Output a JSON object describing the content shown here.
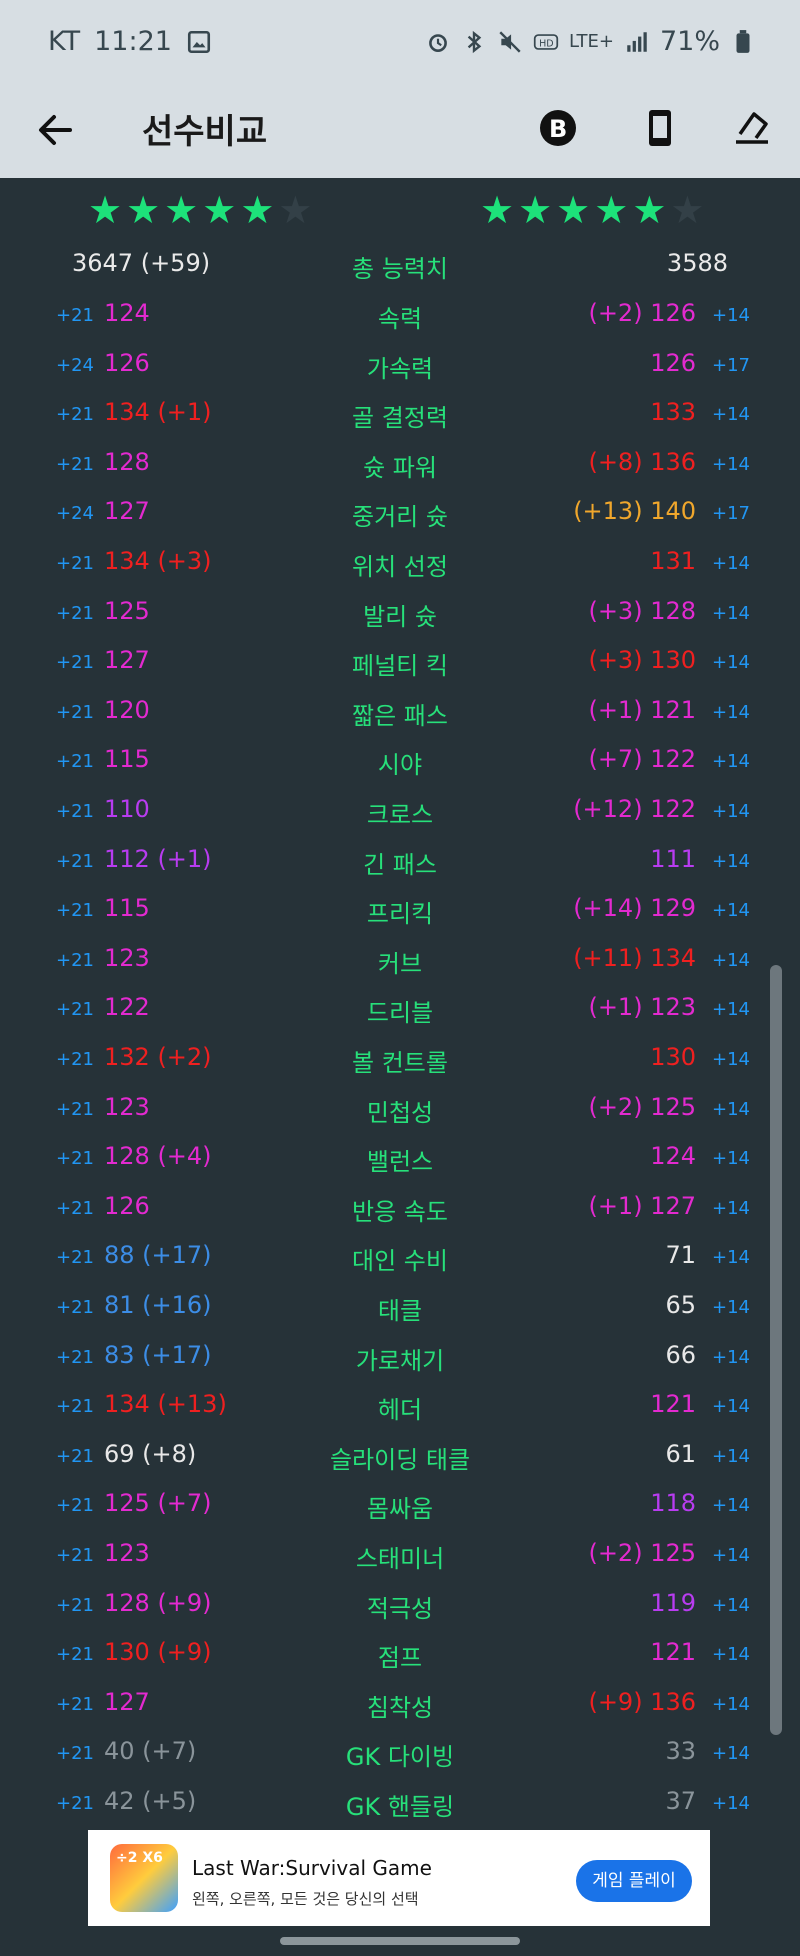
{
  "status": {
    "carrier": "KT",
    "time": "11:21",
    "battery": "71%",
    "net": "LTE+"
  },
  "appbar": {
    "title": "선수비교"
  },
  "stars": {
    "left_on": 5,
    "right_on": 5,
    "total": 6
  },
  "total": {
    "label": "총 능력치",
    "left": "3647 (+59)",
    "right": "3588"
  },
  "rows": [
    {
      "lb": "+21",
      "lv": "124",
      "lc": "c-mag",
      "label": "속력",
      "rv": "(+2) 126",
      "rc": "c-mag",
      "rb": "+14"
    },
    {
      "lb": "+24",
      "lv": "126",
      "lc": "c-mag",
      "label": "가속력",
      "rv": "126",
      "rc": "c-mag",
      "rb": "+17"
    },
    {
      "lb": "+21",
      "lv": "134 (+1)",
      "lc": "c-red",
      "label": "골 결정력",
      "rv": "133",
      "rc": "c-red",
      "rb": "+14"
    },
    {
      "lb": "+21",
      "lv": "128",
      "lc": "c-mag",
      "label": "슛 파워",
      "rv": "(+8) 136",
      "rc": "c-red",
      "rb": "+14"
    },
    {
      "lb": "+24",
      "lv": "127",
      "lc": "c-mag",
      "label": "중거리 슛",
      "rv": "(+13) 140",
      "rc": "c-org",
      "rb": "+17"
    },
    {
      "lb": "+21",
      "lv": "134 (+3)",
      "lc": "c-red",
      "label": "위치 선정",
      "rv": "131",
      "rc": "c-red",
      "rb": "+14"
    },
    {
      "lb": "+21",
      "lv": "125",
      "lc": "c-mag",
      "label": "발리 슛",
      "rv": "(+3) 128",
      "rc": "c-mag",
      "rb": "+14"
    },
    {
      "lb": "+21",
      "lv": "127",
      "lc": "c-mag",
      "label": "페널티 킥",
      "rv": "(+3) 130",
      "rc": "c-red",
      "rb": "+14"
    },
    {
      "lb": "+21",
      "lv": "120",
      "lc": "c-mag",
      "label": "짧은 패스",
      "rv": "(+1) 121",
      "rc": "c-mag",
      "rb": "+14"
    },
    {
      "lb": "+21",
      "lv": "115",
      "lc": "c-mag",
      "label": "시야",
      "rv": "(+7) 122",
      "rc": "c-mag",
      "rb": "+14"
    },
    {
      "lb": "+21",
      "lv": "110",
      "lc": "c-pur",
      "label": "크로스",
      "rv": "(+12) 122",
      "rc": "c-mag",
      "rb": "+14"
    },
    {
      "lb": "+21",
      "lv": "112 (+1)",
      "lc": "c-pur",
      "label": "긴 패스",
      "rv": "111",
      "rc": "c-pur",
      "rb": "+14"
    },
    {
      "lb": "+21",
      "lv": "115",
      "lc": "c-mag",
      "label": "프리킥",
      "rv": "(+14) 129",
      "rc": "c-mag",
      "rb": "+14"
    },
    {
      "lb": "+21",
      "lv": "123",
      "lc": "c-mag",
      "label": "커브",
      "rv": "(+11) 134",
      "rc": "c-red",
      "rb": "+14"
    },
    {
      "lb": "+21",
      "lv": "122",
      "lc": "c-mag",
      "label": "드리블",
      "rv": "(+1) 123",
      "rc": "c-mag",
      "rb": "+14"
    },
    {
      "lb": "+21",
      "lv": "132 (+2)",
      "lc": "c-red",
      "label": "볼 컨트롤",
      "rv": "130",
      "rc": "c-red",
      "rb": "+14"
    },
    {
      "lb": "+21",
      "lv": "123",
      "lc": "c-mag",
      "label": "민첩성",
      "rv": "(+2) 125",
      "rc": "c-mag",
      "rb": "+14"
    },
    {
      "lb": "+21",
      "lv": "128 (+4)",
      "lc": "c-mag",
      "label": "밸런스",
      "rv": "124",
      "rc": "c-mag",
      "rb": "+14"
    },
    {
      "lb": "+21",
      "lv": "126",
      "lc": "c-mag",
      "label": "반응 속도",
      "rv": "(+1) 127",
      "rc": "c-mag",
      "rb": "+14"
    },
    {
      "lb": "+21",
      "lv": "88 (+17)",
      "lc": "c-blu",
      "label": "대인 수비",
      "rv": "71",
      "rc": "c-wht",
      "rb": "+14"
    },
    {
      "lb": "+21",
      "lv": "81 (+16)",
      "lc": "c-blu",
      "label": "태클",
      "rv": "65",
      "rc": "c-wht",
      "rb": "+14"
    },
    {
      "lb": "+21",
      "lv": "83 (+17)",
      "lc": "c-blu",
      "label": "가로채기",
      "rv": "66",
      "rc": "c-wht",
      "rb": "+14"
    },
    {
      "lb": "+21",
      "lv": "134 (+13)",
      "lc": "c-red",
      "label": "헤더",
      "rv": "121",
      "rc": "c-mag",
      "rb": "+14"
    },
    {
      "lb": "+21",
      "lv": "69 (+8)",
      "lc": "c-wht",
      "label": "슬라이딩 태클",
      "rv": "61",
      "rc": "c-wht",
      "rb": "+14"
    },
    {
      "lb": "+21",
      "lv": "125 (+7)",
      "lc": "c-mag",
      "label": "몸싸움",
      "rv": "118",
      "rc": "c-pur",
      "rb": "+14"
    },
    {
      "lb": "+21",
      "lv": "123",
      "lc": "c-mag",
      "label": "스태미너",
      "rv": "(+2) 125",
      "rc": "c-mag",
      "rb": "+14"
    },
    {
      "lb": "+21",
      "lv": "128 (+9)",
      "lc": "c-mag",
      "label": "적극성",
      "rv": "119",
      "rc": "c-pur",
      "rb": "+14"
    },
    {
      "lb": "+21",
      "lv": "130 (+9)",
      "lc": "c-red",
      "label": "점프",
      "rv": "121",
      "rc": "c-mag",
      "rb": "+14"
    },
    {
      "lb": "+21",
      "lv": "127",
      "lc": "c-mag",
      "label": "침착성",
      "rv": "(+9) 136",
      "rc": "c-red",
      "rb": "+14"
    },
    {
      "lb": "+21",
      "lv": "40 (+7)",
      "lc": "c-gry",
      "label": "GK 다이빙",
      "rv": "33",
      "rc": "c-gry",
      "rb": "+14"
    },
    {
      "lb": "+21",
      "lv": "42 (+5)",
      "lc": "c-gry",
      "label": "GK 핸들링",
      "rv": "37",
      "rc": "c-gry",
      "rb": "+14"
    }
  ],
  "ad": {
    "icon_text": "÷2 X6",
    "title": "Last War:Survival Game",
    "subtitle": "왼쪽, 오른쪽, 모든 것은 당신의 선택",
    "cta": "게임 플레이"
  }
}
